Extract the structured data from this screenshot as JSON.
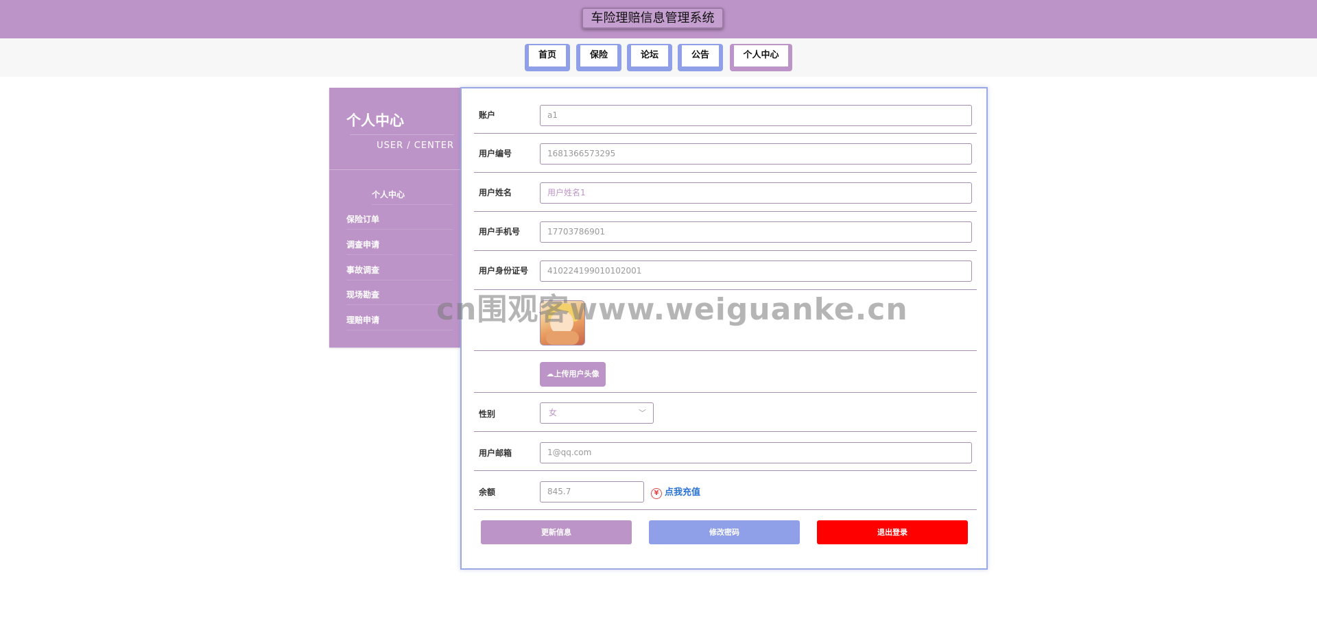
{
  "header": {
    "title": "车险理赔信息管理系统"
  },
  "nav": {
    "items": [
      {
        "label": "首页"
      },
      {
        "label": "保险"
      },
      {
        "label": "论坛"
      },
      {
        "label": "公告"
      },
      {
        "label": "个人中心"
      }
    ]
  },
  "sidebar": {
    "title": "个人中心",
    "subtitle": "USER / CENTER",
    "items": [
      {
        "label": "个人中心"
      },
      {
        "label": "保险订单"
      },
      {
        "label": "调查申请"
      },
      {
        "label": "事故调查"
      },
      {
        "label": "现场勘查"
      },
      {
        "label": "理赔申请"
      }
    ]
  },
  "form": {
    "account": {
      "label": "账户",
      "value": "a1"
    },
    "user_no": {
      "label": "用户编号",
      "value": "1681366573295"
    },
    "user_name": {
      "label": "用户姓名",
      "value": "用户姓名1"
    },
    "phone": {
      "label": "用户手机号",
      "value": "17703786901"
    },
    "id_card": {
      "label": "用户身份证号",
      "value": "410224199010102001"
    },
    "upload_label": "上传用户头像",
    "gender": {
      "label": "性别",
      "value": "女"
    },
    "email": {
      "label": "用户邮箱",
      "value": "1@qq.com"
    },
    "balance": {
      "label": "余额",
      "value": "845.7",
      "recharge": "点我充值"
    }
  },
  "actions": {
    "update": "更新信息",
    "change_password": "修改密码",
    "logout": "退出登录"
  },
  "watermark": "cn围观客www.weiguanke.cn",
  "colors": {
    "primary": "#bd94c8",
    "accent": "#8fa0e8",
    "danger": "#ff0000"
  }
}
